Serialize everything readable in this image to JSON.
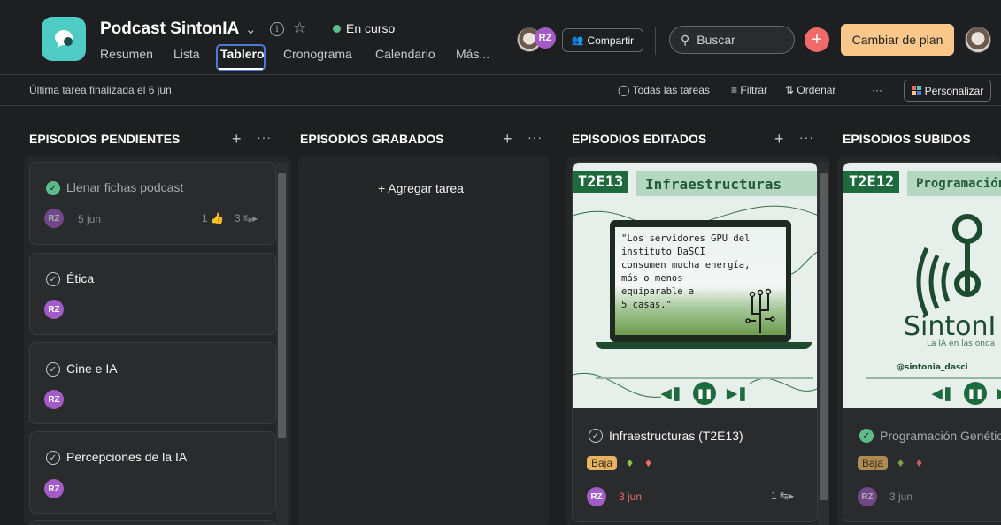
{
  "header": {
    "project_title": "Podcast SintonIA",
    "status": "En curso",
    "tabs": [
      "Resumen",
      "Lista",
      "Tablero",
      "Cronograma",
      "Calendario",
      "Más..."
    ],
    "active_tab": "Tablero",
    "avatar_initials": "RZ",
    "share_label": "Compartir",
    "search_placeholder": "Buscar",
    "upgrade_label": "Cambiar de plan"
  },
  "subbar": {
    "last_task": "Última tarea finalizada el 6 jun",
    "all_tasks": "Todas las tareas",
    "filter": "Filtrar",
    "sort": "Ordenar",
    "more": "···",
    "customize": "Personalizar"
  },
  "columns": [
    {
      "title": "EPISODIOS PENDIENTES",
      "cards": [
        {
          "title": "Llenar fichas podcast",
          "done": true,
          "assignee": "RZ",
          "due": "5 jun",
          "likes": "1",
          "subtasks": "3"
        },
        {
          "title": "Ética",
          "done": false,
          "assignee": "RZ"
        },
        {
          "title": "Cine e IA",
          "done": false,
          "assignee": "RZ"
        },
        {
          "title": "Percepciones de la IA",
          "done": false,
          "assignee": "RZ"
        }
      ]
    },
    {
      "title": "EPISODIOS GRABADOS",
      "add_task": "+ Agregar tarea"
    },
    {
      "title": "EPISODIOS EDITADOS",
      "cards": [
        {
          "cover_code": "T2E13",
          "cover_title": "Infraestructuras",
          "cover_quote": "\"Los servidores GPU del\ninstituto DaSCI\nconsumen mucha energía,\nmás o menos\nequiparable a\n5 casas.\"",
          "title": "Infraestructuras (T2E13)",
          "done": false,
          "priority": "Baja",
          "assignee": "RZ",
          "due": "3 jun",
          "subtasks": "1"
        }
      ]
    },
    {
      "title": "EPISODIOS SUBIDOS",
      "cards": [
        {
          "cover_code": "T2E12",
          "cover_title": "Programación",
          "cover_logo": "SintonI",
          "cover_tagline": "La IA en las onda",
          "cover_handle": "@sintonia_dasci",
          "title": "Programación Genétic",
          "done": true,
          "priority": "Baja",
          "assignee": "RZ",
          "due": "3 jun"
        }
      ]
    }
  ],
  "colors": {
    "background": "#1e1f21",
    "accent_red": "#f06a6a",
    "upgrade": "#f9c78a",
    "teal": "#4ecbc4",
    "done_green": "#5dbb8a"
  }
}
